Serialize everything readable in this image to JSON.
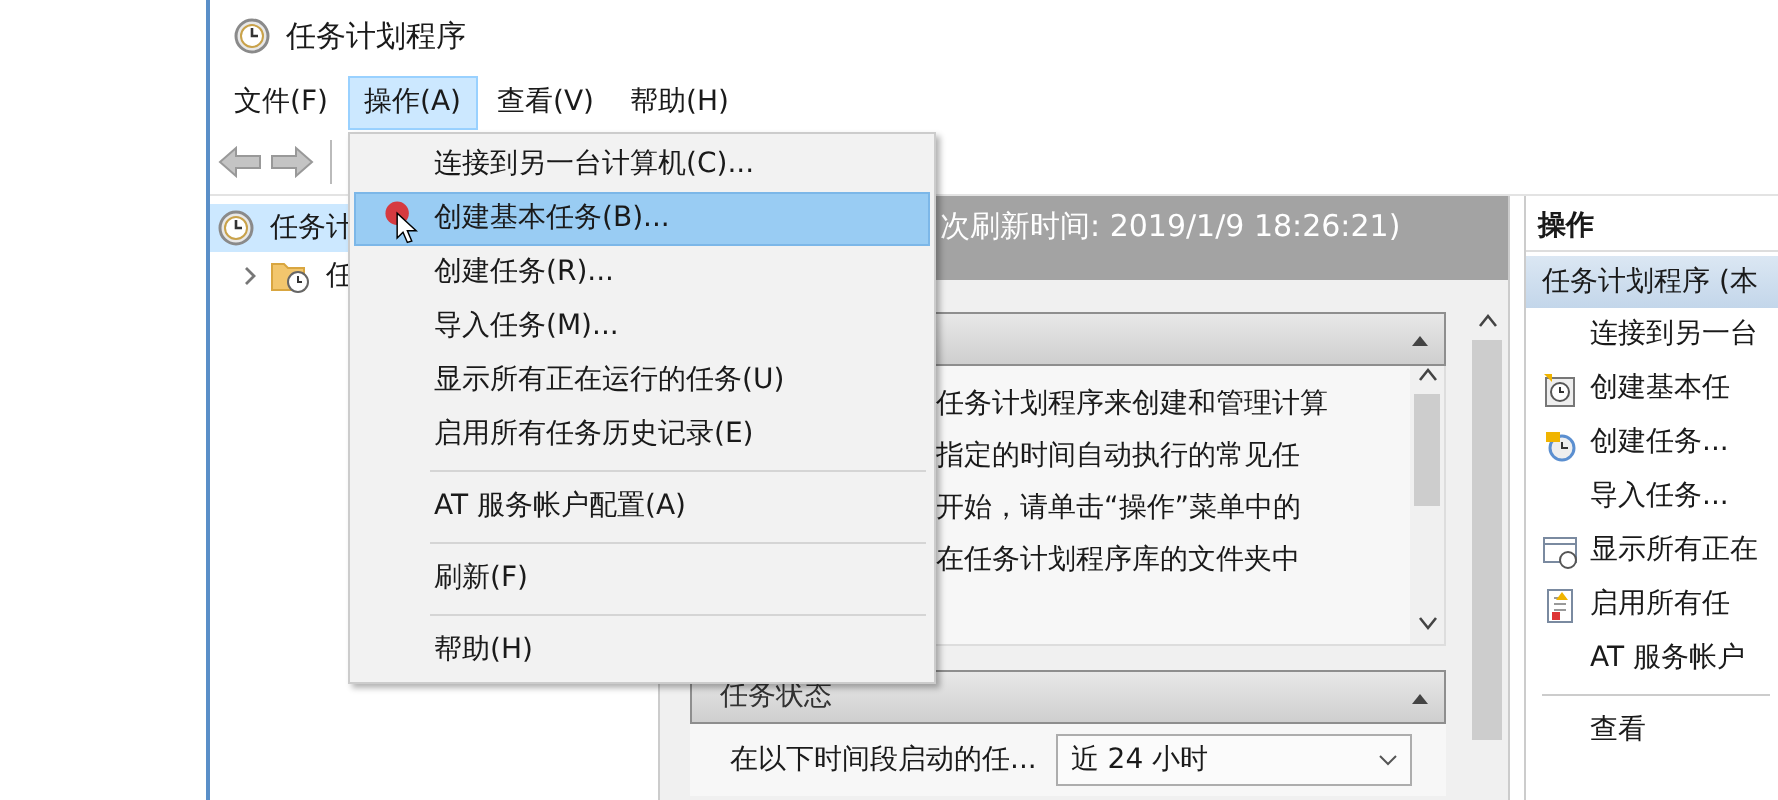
{
  "window": {
    "title": "任务计划程序"
  },
  "menubar": [
    {
      "label": "文件(F)",
      "selected": false
    },
    {
      "label": "操作(A)",
      "selected": true
    },
    {
      "label": "查看(V)",
      "selected": false
    },
    {
      "label": "帮助(H)",
      "selected": false
    }
  ],
  "dropdown": [
    {
      "kind": "item",
      "label": "连接到另一台计算机(C)...",
      "selected": false
    },
    {
      "kind": "item",
      "label": "创建基本任务(B)...",
      "selected": true
    },
    {
      "kind": "item",
      "label": "创建任务(R)...",
      "selected": false
    },
    {
      "kind": "item",
      "label": "导入任务(M)...",
      "selected": false
    },
    {
      "kind": "item",
      "label": "显示所有正在运行的任务(U)",
      "selected": false
    },
    {
      "kind": "item",
      "label": "启用所有任务历史记录(E)",
      "selected": false
    },
    {
      "kind": "separator"
    },
    {
      "kind": "item",
      "label": "AT 服务帐户配置(A)",
      "selected": false
    },
    {
      "kind": "separator"
    },
    {
      "kind": "item",
      "label": "刷新(F)",
      "selected": false
    },
    {
      "kind": "separator"
    },
    {
      "kind": "item",
      "label": "帮助(H)",
      "selected": false
    }
  ],
  "tree": [
    {
      "label": "任务计",
      "selected": true,
      "children": [
        {
          "label": "任",
          "selected": false,
          "expanded": false
        }
      ]
    }
  ],
  "center": {
    "refresh_text": "次刷新时间: 2019/1/9 18:26:21)",
    "overview": {
      "expanded": true,
      "lines": [
        "任务计划程序来创建和管理计算",
        "指定的时间自动执行的常见任",
        "开始，请单击“操作”菜单中的",
        "在任务计划程序库的文件夹中"
      ]
    },
    "status": {
      "title": "任务状态",
      "expanded": true,
      "filter_label": "在以下时间段启动的任...",
      "filter_value": "近 24 小时"
    }
  },
  "actions": {
    "header": "操作",
    "group": {
      "label": "任务计划程序 (本",
      "selected": true
    },
    "items": [
      {
        "kind": "plain",
        "label": "连接到另一台"
      },
      {
        "kind": "basic-task",
        "label": "创建基本任"
      },
      {
        "kind": "new-task",
        "label": "创建任务..."
      },
      {
        "kind": "plain",
        "label": "导入任务..."
      },
      {
        "kind": "running",
        "label": "显示所有正在"
      },
      {
        "kind": "history",
        "label": "启用所有任"
      },
      {
        "kind": "plain",
        "label": "AT 服务帐户"
      },
      {
        "kind": "separator"
      },
      {
        "kind": "plain",
        "label": "查看"
      }
    ]
  }
}
